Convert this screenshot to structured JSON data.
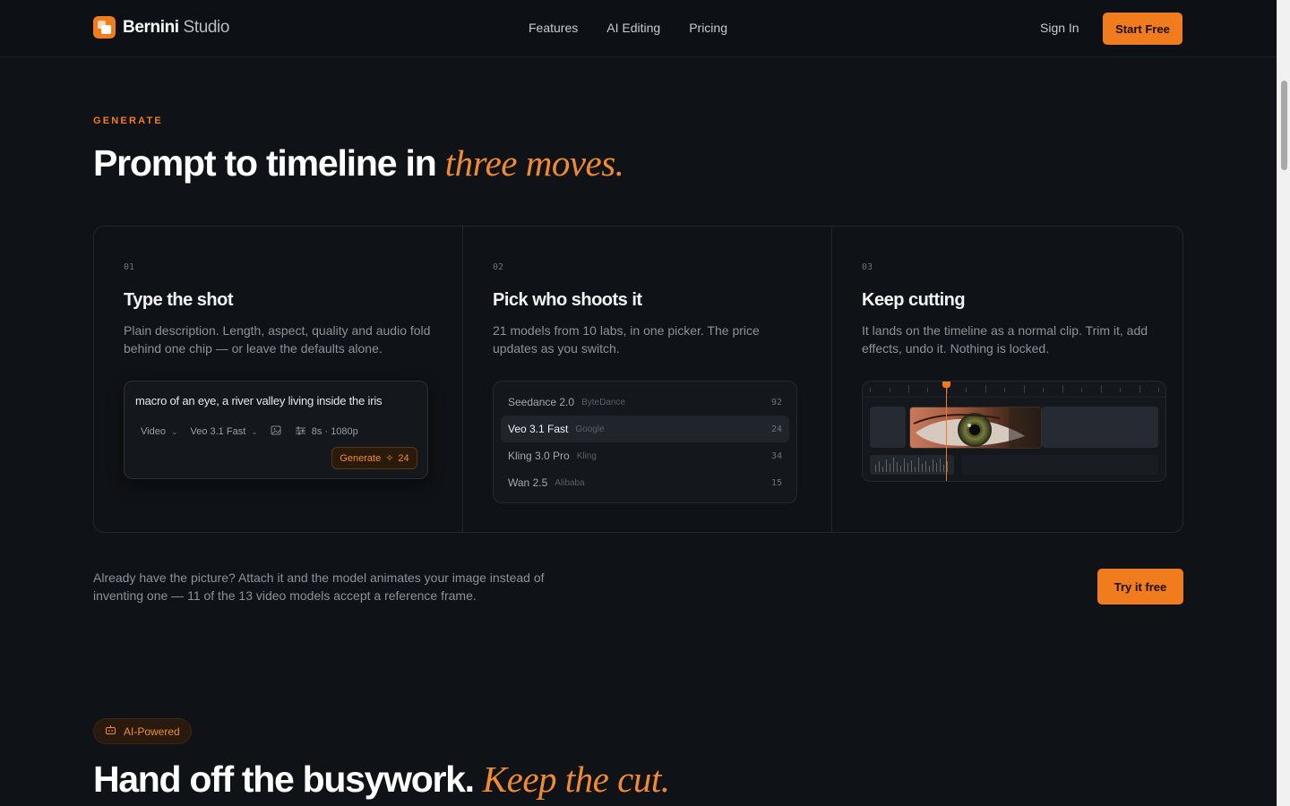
{
  "nav": {
    "brand_name": "Bernini",
    "brand_suffix": "Studio",
    "links": [
      "Features",
      "AI Editing",
      "Pricing"
    ],
    "sign_in": "Sign In",
    "cta": "Start Free",
    "accent": "#f07c1e"
  },
  "hero": {
    "eyebrow": "GENERATE",
    "title_plain": "Prompt to timeline in",
    "title_accent": "three moves."
  },
  "steps": [
    {
      "num": "01",
      "title": "Type the shot",
      "desc": "Plain description. Length, aspect, quality and audio fold behind one chip — or leave the defaults alone.",
      "prompt": {
        "text": "macro of an eye, a river valley living inside the iris",
        "chip_type": "Video",
        "chip_model": "Veo 3.1 Fast",
        "chip_settings": "8s · 1080p",
        "generate_label": "Generate",
        "generate_cost": "24"
      }
    },
    {
      "num": "02",
      "title": "Pick who shoots it",
      "desc": "21 models from 10 labs, in one picker. The price updates as you switch.",
      "models": [
        {
          "name": "Seedance 2.0",
          "lab": "ByteDance",
          "price": "92"
        },
        {
          "name": "Veo 3.1 Fast",
          "lab": "Google",
          "price": "24",
          "active": true
        },
        {
          "name": "Kling 3.0 Pro",
          "lab": "Kling",
          "price": "34"
        },
        {
          "name": "Wan 2.5",
          "lab": "Alibaba",
          "price": "15"
        }
      ]
    },
    {
      "num": "03",
      "title": "Keep cutting",
      "desc": "It lands on the timeline as a normal clip. Trim it, add effects, undo it. Nothing is locked."
    }
  ],
  "attach": {
    "text": "Already have the picture? Attach it and the model animates your image instead of inventing one — 11 of the 13 video models accept a reference frame.",
    "cta": "Try it free"
  },
  "ai_section": {
    "badge": "AI-Powered",
    "title_plain": "Hand off the busywork.",
    "title_accent": "Keep the cut."
  }
}
